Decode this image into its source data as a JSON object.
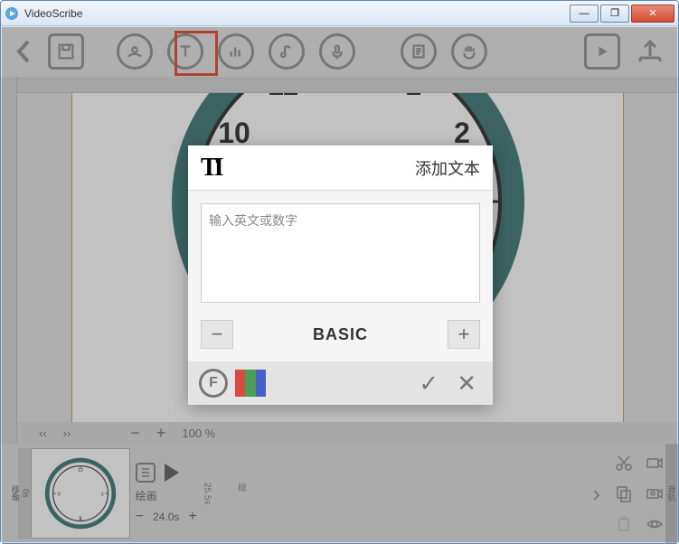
{
  "window": {
    "title": "VideoScribe"
  },
  "toolbar": {
    "icons": [
      "back",
      "save",
      "image",
      "text",
      "chart",
      "music",
      "mic",
      "page",
      "hand",
      "play",
      "export"
    ]
  },
  "canvas": {
    "zoom_label": "100 %",
    "scroll_left": "‹‹",
    "scroll_right": "››",
    "zoom_out": "−",
    "zoom_in": "+"
  },
  "timeline": {
    "thumb_meta_top": "0s",
    "thumb_meta_bottom": "移动",
    "clip_label": "绘画",
    "duration": "24.0s",
    "duration2": "25.5s",
    "duration2_label": "绘",
    "minus": "−",
    "plus": "+",
    "side_label": "音轨"
  },
  "dialog": {
    "title": "添加文本",
    "placeholder": "输入英文或数字",
    "font_name": "BASIC",
    "font_btn_label": "F",
    "colors": [
      "#d94a3f",
      "#4b9e55",
      "#4760c7"
    ]
  }
}
